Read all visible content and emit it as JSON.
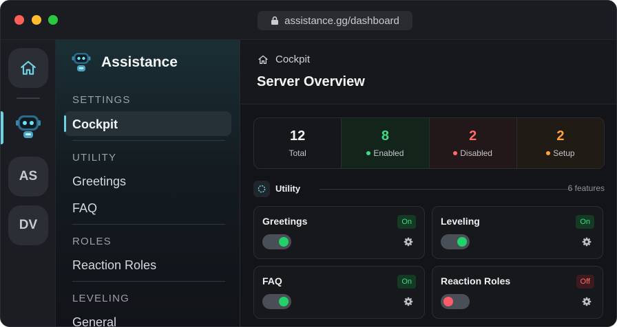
{
  "browser": {
    "url": "assistance.gg/dashboard"
  },
  "rail": {
    "items": [
      {
        "label": "AS"
      },
      {
        "label": "DV"
      }
    ]
  },
  "sidebar": {
    "brand": "Assistance",
    "sections": [
      {
        "title": "SETTINGS",
        "items": [
          "Cockpit"
        ]
      },
      {
        "title": "UTILITY",
        "items": [
          "Greetings",
          "FAQ"
        ]
      },
      {
        "title": "ROLES",
        "items": [
          "Reaction Roles"
        ]
      },
      {
        "title": "LEVELING",
        "items": [
          "General"
        ]
      }
    ]
  },
  "header": {
    "breadcrumb": "Cockpit",
    "title": "Server Overview"
  },
  "stats": [
    {
      "value": "12",
      "label": "Total",
      "color": "#f3f4f6"
    },
    {
      "value": "8",
      "label": "Enabled",
      "color": "#3ddc84"
    },
    {
      "value": "2",
      "label": "Disabled",
      "color": "#ff6b6b"
    },
    {
      "value": "2",
      "label": "Setup",
      "color": "#ffa23a"
    }
  ],
  "section": {
    "title": "Utility",
    "count": "6 features"
  },
  "features": [
    {
      "name": "Greetings",
      "status": "On",
      "enabled": true
    },
    {
      "name": "Leveling",
      "status": "On",
      "enabled": true
    },
    {
      "name": "FAQ",
      "status": "On",
      "enabled": true
    },
    {
      "name": "Reaction Roles",
      "status": "Off",
      "enabled": false
    }
  ]
}
